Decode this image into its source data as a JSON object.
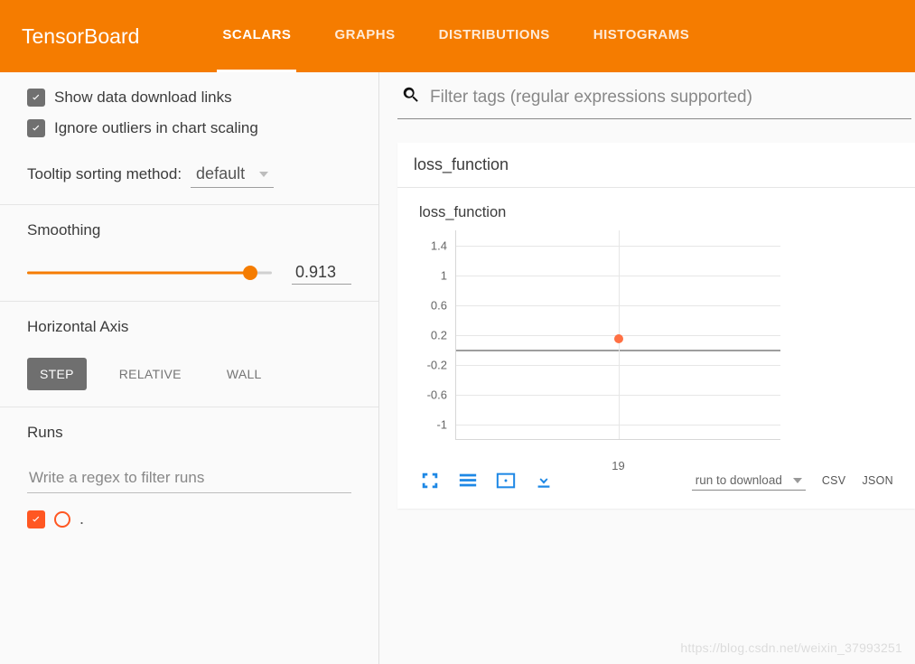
{
  "brand": "TensorBoard",
  "tabs": [
    "SCALARS",
    "GRAPHS",
    "DISTRIBUTIONS",
    "HISTOGRAMS"
  ],
  "active_tab": 0,
  "sidebar": {
    "show_download_links": {
      "label": "Show data download links",
      "checked": true
    },
    "ignore_outliers": {
      "label": "Ignore outliers in chart scaling",
      "checked": true
    },
    "tooltip_label": "Tooltip sorting method:",
    "tooltip_value": "default",
    "smoothing_label": "Smoothing",
    "smoothing_value": "0.913",
    "smoothing_frac": 0.913,
    "axis_label": "Horizontal Axis",
    "axis_options": [
      "STEP",
      "RELATIVE",
      "WALL"
    ],
    "axis_active": 0,
    "runs_label": "Runs",
    "runs_filter_placeholder": "Write a regex to filter runs",
    "runs": [
      {
        "name": ".",
        "checked": true
      }
    ]
  },
  "filter_placeholder": "Filter tags (regular expressions supported)",
  "card": {
    "group_title": "loss_function",
    "chart_title": "loss_function",
    "run_to_download": "run to download",
    "fmt_csv": "CSV",
    "fmt_json": "JSON"
  },
  "chart_data": {
    "type": "scatter",
    "title": "loss_function",
    "x": [
      19
    ],
    "y": [
      0.15
    ],
    "xlabel": "",
    "ylabel": "",
    "y_ticks": [
      1.4,
      1,
      0.6,
      0.2,
      -0.2,
      -0.6,
      -1
    ],
    "x_ticks": [
      19
    ],
    "ylim": [
      -1.2,
      1.6
    ],
    "xlim": [
      0,
      38
    ]
  },
  "watermark": "https://blog.csdn.net/weixin_37993251"
}
